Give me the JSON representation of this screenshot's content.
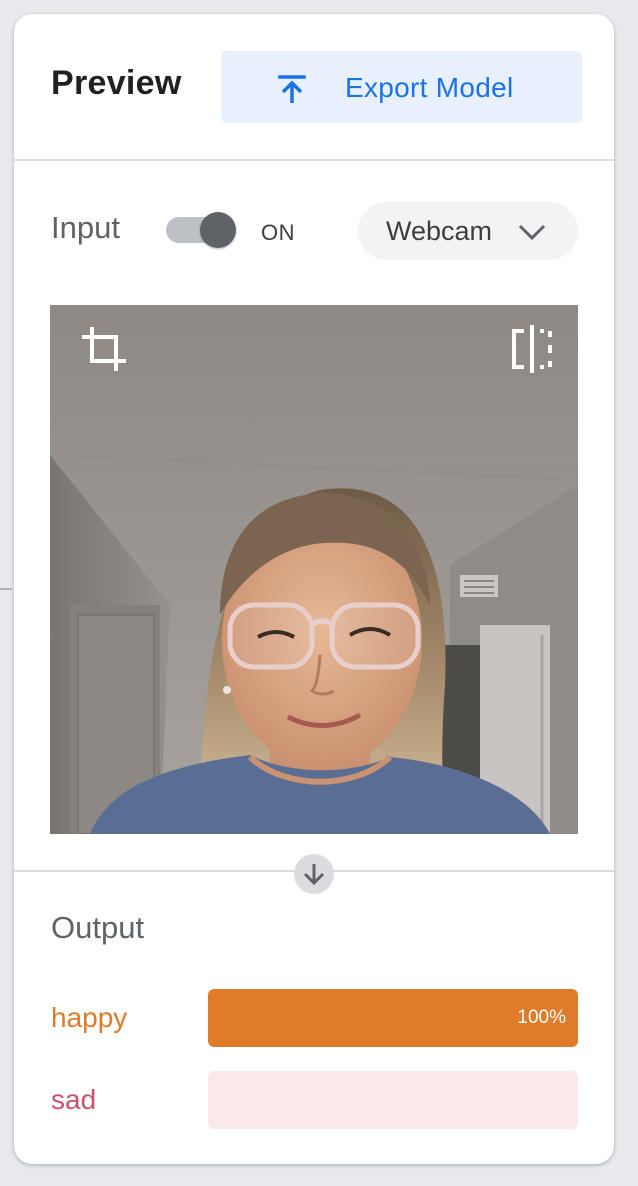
{
  "header": {
    "title": "Preview",
    "export_label": "Export Model",
    "export_icon": "upload-icon"
  },
  "input": {
    "label": "Input",
    "toggle_on": true,
    "toggle_state": "ON",
    "source": "Webcam",
    "source_icon": "chevron-down-icon",
    "crop_icon": "crop-icon",
    "flip_icon": "flip-horizontal-icon"
  },
  "output": {
    "title": "Output",
    "arrow_icon": "arrow-down-icon",
    "classes": [
      {
        "label": "happy",
        "percent": 100,
        "percent_text": "100%",
        "color": "#e07b29",
        "bg": "#fbe2cd"
      },
      {
        "label": "sad",
        "percent": 0,
        "percent_text": "",
        "color": "#c9526d",
        "bg": "#fbe8ea"
      }
    ]
  },
  "colors": {
    "accent": "#1a73e8",
    "accent_bg": "#e8f0fe",
    "happy": "#e07b29",
    "sad": "#c9526d"
  }
}
